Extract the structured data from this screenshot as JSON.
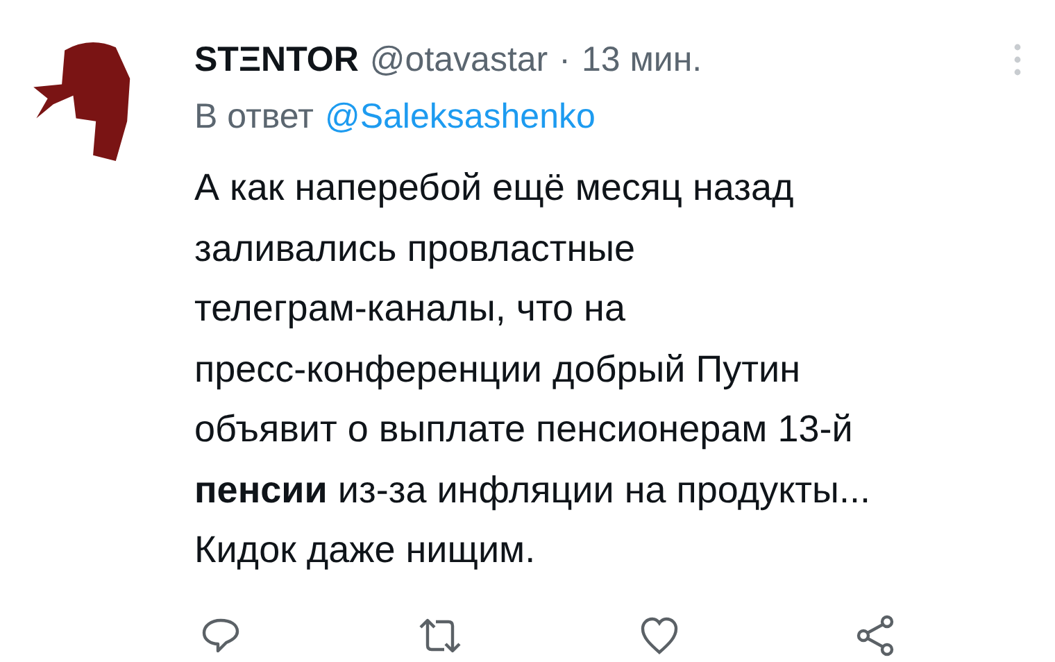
{
  "tweet": {
    "display_name": "STΞNTOR",
    "handle": "@otavastar",
    "separator": "·",
    "time": "13 мин.",
    "reply_prefix": "В ответ",
    "reply_to": "@Saleksashenko",
    "text": "А как наперебой ещё месяц назад\nзаливались провластные\nтелеграм-каналы, что на\nпресс-конференции добрый Путин\nобъявит о выплате пенсионерам 13-й\n**пенсии** из-за инфляции на продукты...\nКидок даже нищим."
  }
}
